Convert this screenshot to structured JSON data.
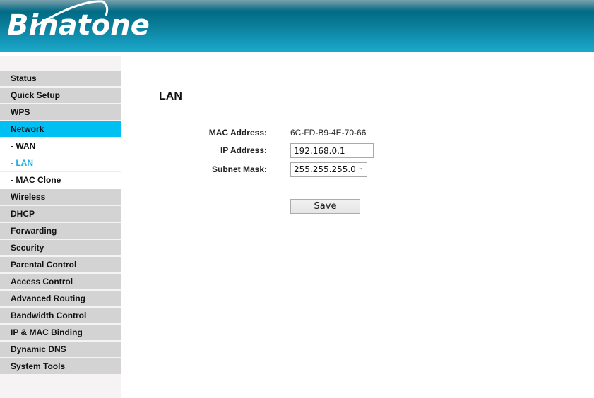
{
  "header": {
    "logo_text": "Binatone",
    "brand_colors": {
      "header_top": "#006b86",
      "header_bottom": "#1ca8ca",
      "active_menu": "#00bff3",
      "active_submenu_text": "#1aaee0"
    }
  },
  "sidebar": {
    "items": [
      {
        "label": "Status",
        "type": "main",
        "state": "normal"
      },
      {
        "label": "Quick Setup",
        "type": "main",
        "state": "normal"
      },
      {
        "label": "WPS",
        "type": "main",
        "state": "normal"
      },
      {
        "label": "Network",
        "type": "main",
        "state": "active"
      },
      {
        "label": "- WAN",
        "type": "sub",
        "state": "normal"
      },
      {
        "label": "- LAN",
        "type": "sub",
        "state": "current"
      },
      {
        "label": "- MAC Clone",
        "type": "sub",
        "state": "normal"
      },
      {
        "label": "Wireless",
        "type": "main",
        "state": "normal"
      },
      {
        "label": "DHCP",
        "type": "main",
        "state": "normal"
      },
      {
        "label": "Forwarding",
        "type": "main",
        "state": "normal"
      },
      {
        "label": "Security",
        "type": "main",
        "state": "normal"
      },
      {
        "label": "Parental Control",
        "type": "main",
        "state": "normal"
      },
      {
        "label": "Access Control",
        "type": "main",
        "state": "normal"
      },
      {
        "label": "Advanced Routing",
        "type": "main",
        "state": "normal"
      },
      {
        "label": "Bandwidth Control",
        "type": "main",
        "state": "normal"
      },
      {
        "label": "IP & MAC Binding",
        "type": "main",
        "state": "normal"
      },
      {
        "label": "Dynamic DNS",
        "type": "main",
        "state": "normal"
      },
      {
        "label": "System Tools",
        "type": "main",
        "state": "normal"
      }
    ]
  },
  "main": {
    "title": "LAN",
    "fields": {
      "mac": {
        "label": "MAC Address:",
        "value": "6C-FD-B9-4E-70-66"
      },
      "ip": {
        "label": "IP Address:",
        "value": "192.168.0.1"
      },
      "subnet": {
        "label": "Subnet Mask:",
        "value": "255.255.255.0",
        "arrow_icon": "chevron-down-icon"
      }
    },
    "save_label": "Save"
  }
}
